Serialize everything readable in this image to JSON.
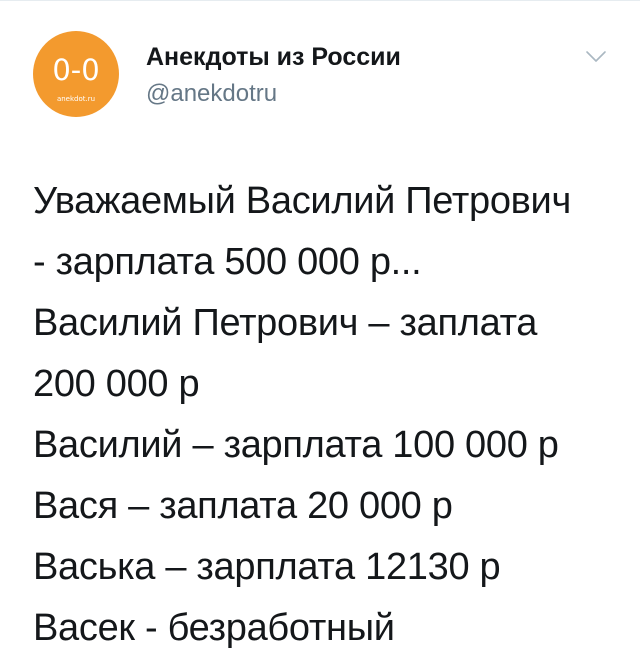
{
  "tweet": {
    "author": {
      "display_name": "Анекдоты из России",
      "handle": "@anekdotru",
      "avatar": {
        "mark": "0-0",
        "caption": "anekdot.ru",
        "color": "#f39a2e"
      }
    },
    "menu_icon": "chevron-down-icon",
    "lines": [
      "Уважаемый Василий Петрович",
      "- зарплата 500 000 р...",
      "Василий Петрович – заплата",
      "200 000 р",
      "Василий – зарплата 100 000 р",
      "Вася – заплата 20 000 р",
      "Васька – зарплата 12130 р",
      "Васек - безработный"
    ]
  },
  "colors": {
    "text": "#14171a",
    "secondary_text": "#657786",
    "divider": "#e6ecf0",
    "background": "#ffffff"
  }
}
